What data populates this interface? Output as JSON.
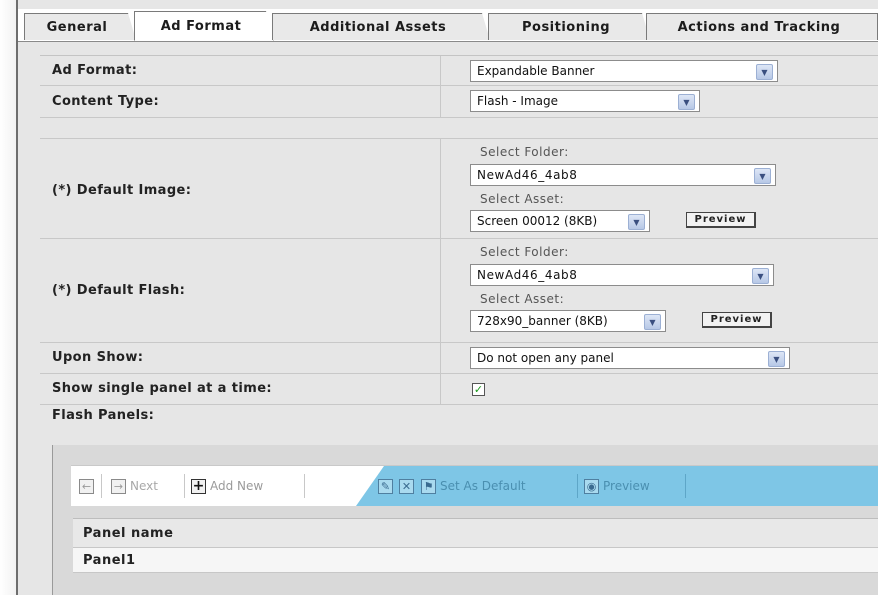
{
  "tabs": [
    {
      "label": "General",
      "active": false
    },
    {
      "label": "Ad Format",
      "active": true
    },
    {
      "label": "Additional Assets",
      "active": false
    },
    {
      "label": "Positioning",
      "active": false
    },
    {
      "label": "Actions and Tracking",
      "active": false
    }
  ],
  "form": {
    "ad_format": {
      "label": "Ad Format:",
      "value": "Expandable Banner"
    },
    "content_type": {
      "label": "Content Type:",
      "value": "Flash - Image"
    },
    "default_image": {
      "label": "(*) Default Image:",
      "folder_label": "Select Folder:",
      "folder_value": "NewAd46_4ab8",
      "asset_label": "Select Asset:",
      "asset_value": "Screen 00012 (8KB)",
      "preview_label": "Preview"
    },
    "default_flash": {
      "label": "(*) Default Flash:",
      "folder_label": "Select Folder:",
      "folder_value": "NewAd46_4ab8",
      "asset_label": "Select Asset:",
      "asset_value": "728x90_banner (8KB)",
      "preview_label": "Preview"
    },
    "upon_show": {
      "label": "Upon Show:",
      "value": "Do not open any panel"
    },
    "single_panel": {
      "label": "Show single panel at a time:",
      "checked": true
    },
    "flash_panels": {
      "label": "Flash Panels:"
    }
  },
  "toolbar": {
    "next_label": "Next",
    "add_new_label": "Add New",
    "set_default_label": "Set As Default",
    "preview_label": "Preview"
  },
  "panels_table": {
    "header": "Panel name",
    "rows": [
      "Panel1"
    ]
  },
  "colors": {
    "toolbar_accent": "#7ec6e6",
    "checkmark": "#1a9a1a"
  }
}
